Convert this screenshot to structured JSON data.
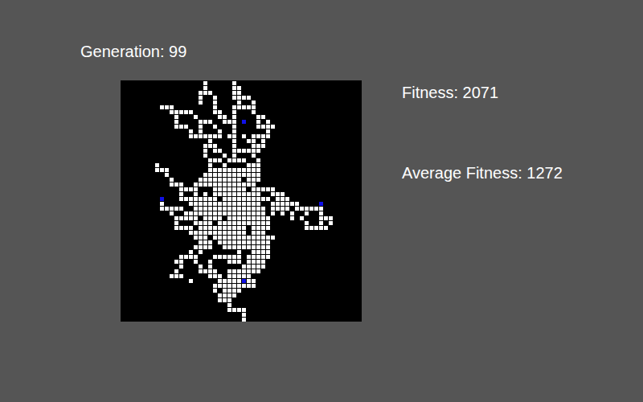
{
  "generation": {
    "label": "Generation: 99"
  },
  "stats": [
    {
      "label": "Fitness: 2071"
    },
    {
      "label": "Average Fitness: 1272"
    }
  ],
  "grid": {
    "size": 50,
    "rows": [
      ".................#.....#",
      ".................#.....##",
      "................###....##",
      "................#..#...####",
      "................#..#....#..#",
      "........###........#...#####",
      "..........#####....##..#...#",
      "...........#...#....##.#....##",
      "...........#....###..###.o..#.#",
      "...........###..#..#...#....####",
      "..............#.#...#..#......#",
      "..............#######.##.#.####",
      "..................#....#..##.#",
      ".................###...#...###",
      ".................#.##..######",
      ".................#...#.#...#",
      "..................###.####..#",
      ".......#..........#..#....###",
      ".......###........###########",
      ".........#.......############",
      "..........#.....#########.###",
      "..........###..#############",
      "............####...#######.#####",
      "............#..#.#.##########..###",
      "........o...########.##########.###",
      "........#.....###############..######....o",
      "........#####..###############.####.######",
      "..........#..#################.#.#.#..#..#",
      "...........#####.####.#########....#.#...###",
      "...........#...####.###########.......#..#.#",
      "...........####.##########.####.......#####",
      "..............############.###",
      "...............###.#############",
      "................###.###########",
      "...............####..##########",
      "..............#.#.......#..####",
      "............####...######.#####",
      "...........##..#..#...###.####",
      "............#...#.#......#####",
      "...........#....####..#######",
      "..........###.....###.#####",
      "..............#.....#####o##",
      "...................#########",
      "...................#.####",
      "....................####",
      "....................###",
      "......................#",
      "......................####",
      ".........................#",
      ".........................#"
    ]
  }
}
